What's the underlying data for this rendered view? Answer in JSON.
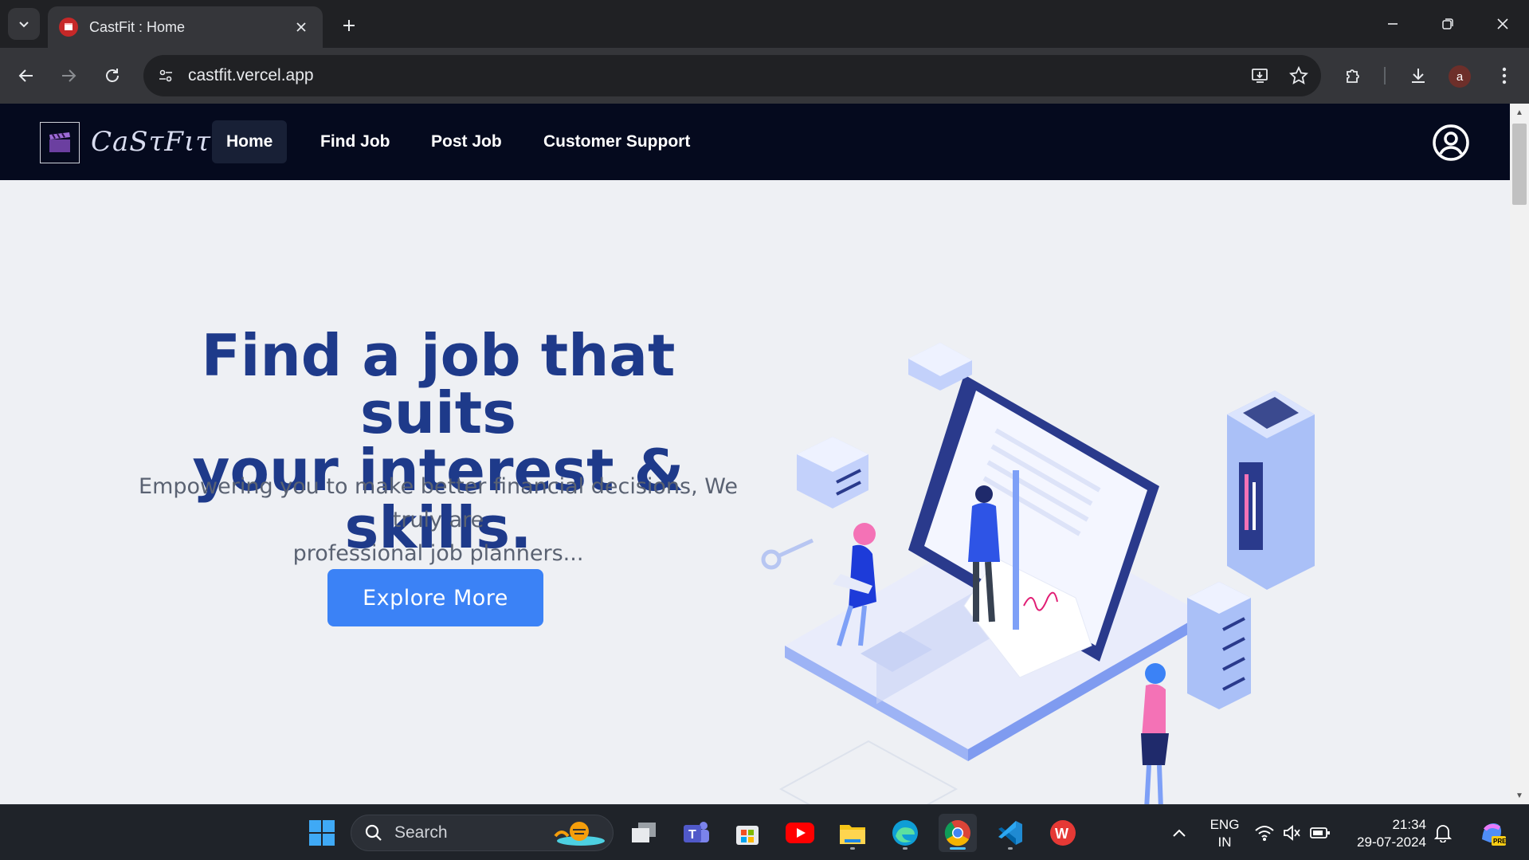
{
  "browser": {
    "tab_title": "CastFit : Home",
    "url": "castfit.vercel.app",
    "profile_initial": "a"
  },
  "site": {
    "logo_text": "CaSτFιτ.",
    "nav": [
      {
        "label": "Home",
        "active": true
      },
      {
        "label": "Find Job",
        "active": false
      },
      {
        "label": "Post Job",
        "active": false
      },
      {
        "label": "Customer Support",
        "active": false
      }
    ]
  },
  "hero": {
    "title_line1": "Find a job that suits",
    "title_line2": "your interest & skills.",
    "subtitle_line1": "Empowering you to make better financial decisions, We truly are",
    "subtitle_line2": "professional job planners...",
    "cta_label": "Explore More"
  },
  "taskbar": {
    "search_label": "Search",
    "lang_line1": "ENG",
    "lang_line2": "IN",
    "time": "21:34",
    "date": "29-07-2024"
  },
  "colors": {
    "nav_bg": "#050a1e",
    "hero_title": "#1e3a8a",
    "cta_bg": "#3b82f6",
    "page_bg": "#eef0f4"
  }
}
